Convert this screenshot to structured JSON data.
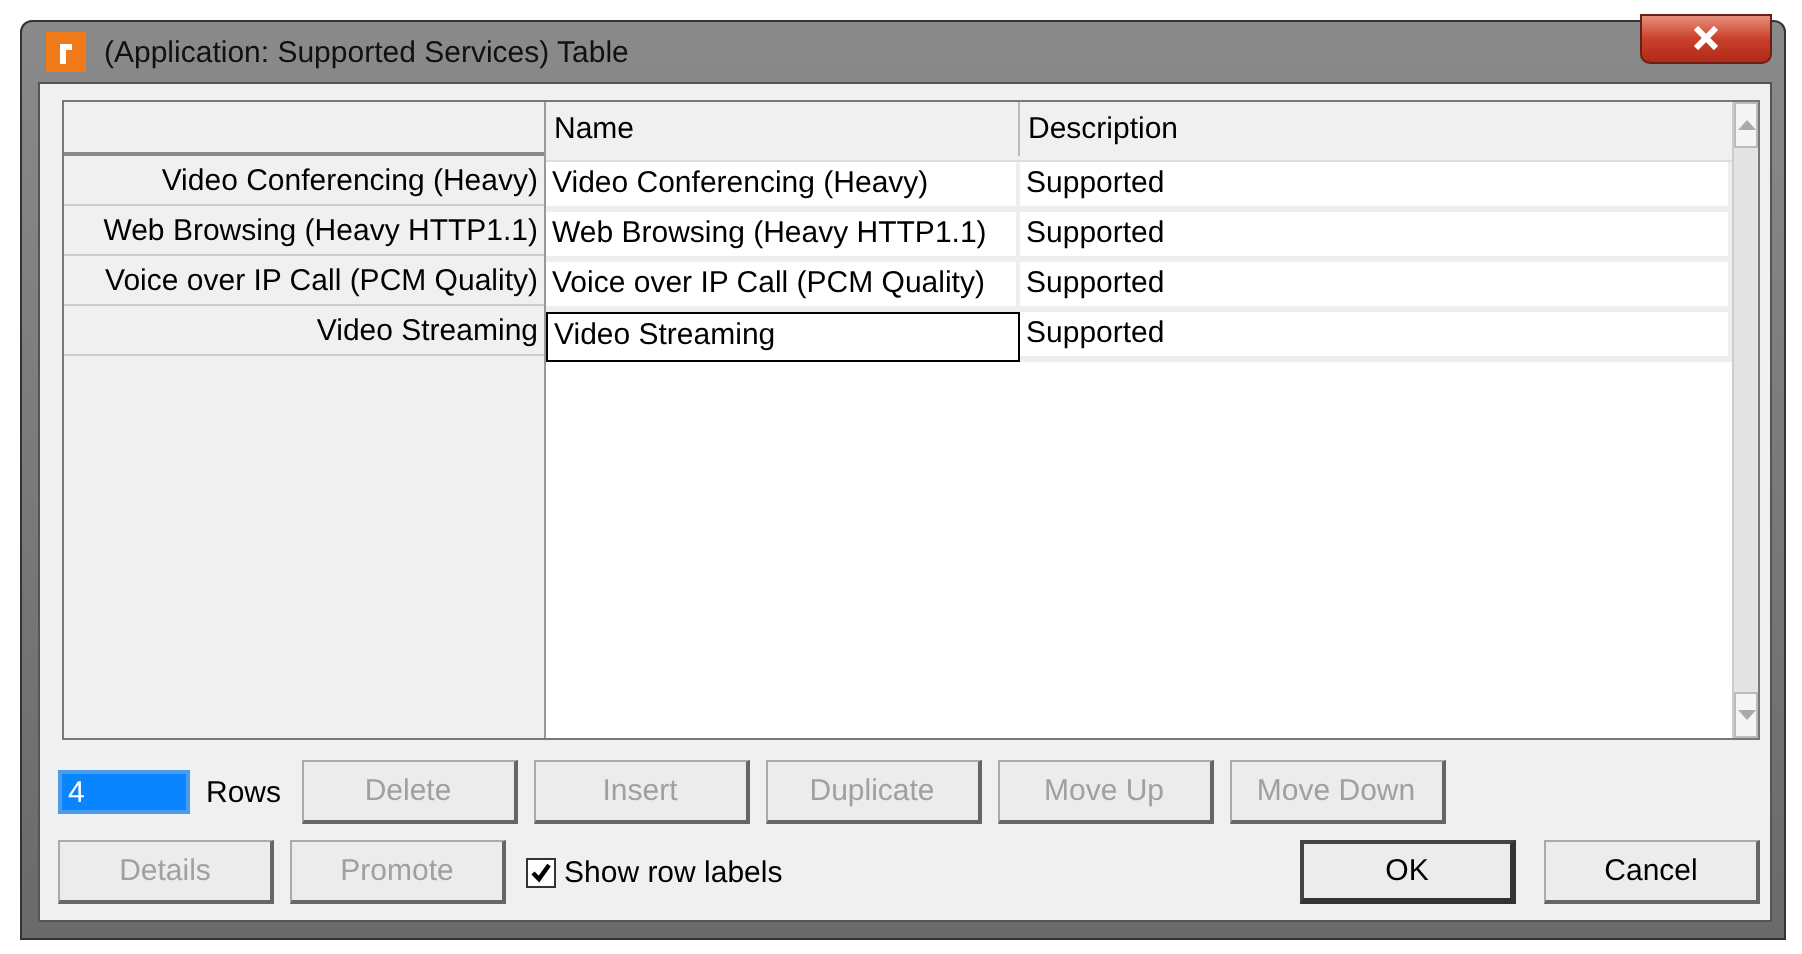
{
  "window": {
    "title": "(Application: Supported Services) Table"
  },
  "table": {
    "columns": [
      "Name",
      "Description"
    ],
    "rows": [
      {
        "label": "Video Conferencing (Heavy)",
        "name": "Video Conferencing (Heavy)",
        "description": "Supported",
        "focused": false
      },
      {
        "label": "Web Browsing (Heavy HTTP1.1)",
        "name": "Web Browsing (Heavy HTTP1.1)",
        "description": "Supported",
        "focused": false
      },
      {
        "label": "Voice over IP Call (PCM Quality)",
        "name": "Voice over IP Call (PCM Quality)",
        "description": "Supported",
        "focused": false
      },
      {
        "label": "Video Streaming",
        "name": "Video Streaming",
        "description": "Supported",
        "focused": true
      }
    ]
  },
  "rows_field": {
    "value": "4",
    "label": "Rows"
  },
  "row_buttons": [
    {
      "label": "Delete",
      "disabled": true
    },
    {
      "label": "Insert",
      "disabled": true
    },
    {
      "label": "Duplicate",
      "disabled": true
    },
    {
      "label": "Move Up",
      "disabled": true
    },
    {
      "label": "Move Down",
      "disabled": true
    }
  ],
  "left_buttons": [
    {
      "label": "Details",
      "disabled": true
    },
    {
      "label": "Promote",
      "disabled": true
    }
  ],
  "show_row_labels": {
    "label": "Show row labels",
    "checked": true
  },
  "dialog_buttons": [
    {
      "label": "OK",
      "disabled": false,
      "default": true
    },
    {
      "label": "Cancel",
      "disabled": false,
      "default": false
    }
  ]
}
